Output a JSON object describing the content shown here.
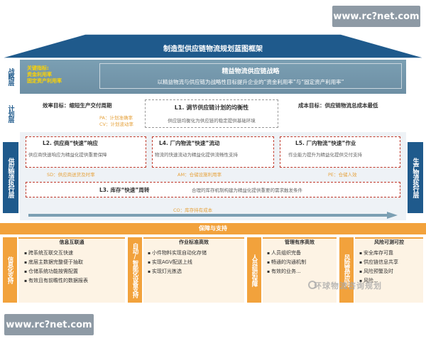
{
  "watermark": {
    "top": "www.rc?net.com",
    "bottom": "www.rc?net.com",
    "overlay": "环球物流咨询规划"
  },
  "title": "制造型供应链物流规划蓝图框架",
  "layers": {
    "strategy": "战略层",
    "plan": "计划层",
    "exec_left": "供应物流执行层",
    "exec_right": "生产物流执行层"
  },
  "strategy": {
    "kpi_head": "关键指标:",
    "kpi1": "资金利用率",
    "kpi2": "固定资产利用率",
    "title": "精益物流供应链战略",
    "desc": "以精益物流与供应链为战略性目标提升企业的“资金利用率”与“固定资产利用率”"
  },
  "plan": {
    "efficiency": "效率目标：缩短生产交付周期",
    "cost": "成本目标：供应链物流总成本最低",
    "pa": "PA：计划准确率",
    "cv": "CV：计划波动率",
    "box_title": "L1. 调节供应链计划的均衡性",
    "box_desc": "供应链均衡化为供应链的稳定提供基础环境"
  },
  "exec": {
    "l2_title": "L2. 供应商“快速”响应",
    "l2_desc": "供应商快速响应为精益化提供重要保障",
    "l2_kpi": "SD：供应商送货及时率",
    "l4_title": "L4. 厂内物流“快速”流动",
    "l4_desc": "物流的快速流动为精益化提供流畅性支持",
    "l4_kpi": "AM：仓储设施利用率",
    "l5_title": "L5. 厂内物流“快速”作业",
    "l5_desc": "作业能力提升为精益化提供交付支持",
    "l5_kpi": "PE：仓储人效",
    "l3_title": "L3. 库存“快速”周转",
    "l3_desc": "合理的库存机制构建为精益化提供重要的需求触发条件",
    "co_kpi": "CO：库存持有成本"
  },
  "support": {
    "title": "保障与支持",
    "pillars": [
      {
        "label": "信息化支持",
        "head": "信息互联通",
        "items": [
          "跨系统互联交互快速",
          "底层主数据完整便于抽取",
          "仓储系统功能按需配置",
          "有效且有前瞻性的数据报表"
        ]
      },
      {
        "label": "自动/智能化设备支持",
        "head": "作业标准高效",
        "items": [
          "小件物料实现自动化存储",
          "实现AGV配送上线",
          "实现灯光拣选"
        ]
      },
      {
        "label": "人员组织保障",
        "head": "管理有序高效",
        "items": [
          "人员组织完备",
          "畅通的沟通机制",
          "有效的业务..."
        ]
      },
      {
        "label": "风险管控应对",
        "head": "风险可测可控",
        "items": [
          "安全库存可靠",
          "供应链信息共享",
          "风险预警及时",
          "风险..."
        ]
      }
    ]
  },
  "colors": {
    "navy": "#1f5a8c",
    "orange": "#f2a23c",
    "slate": "#6d8fa4",
    "red": "#c0392b"
  }
}
